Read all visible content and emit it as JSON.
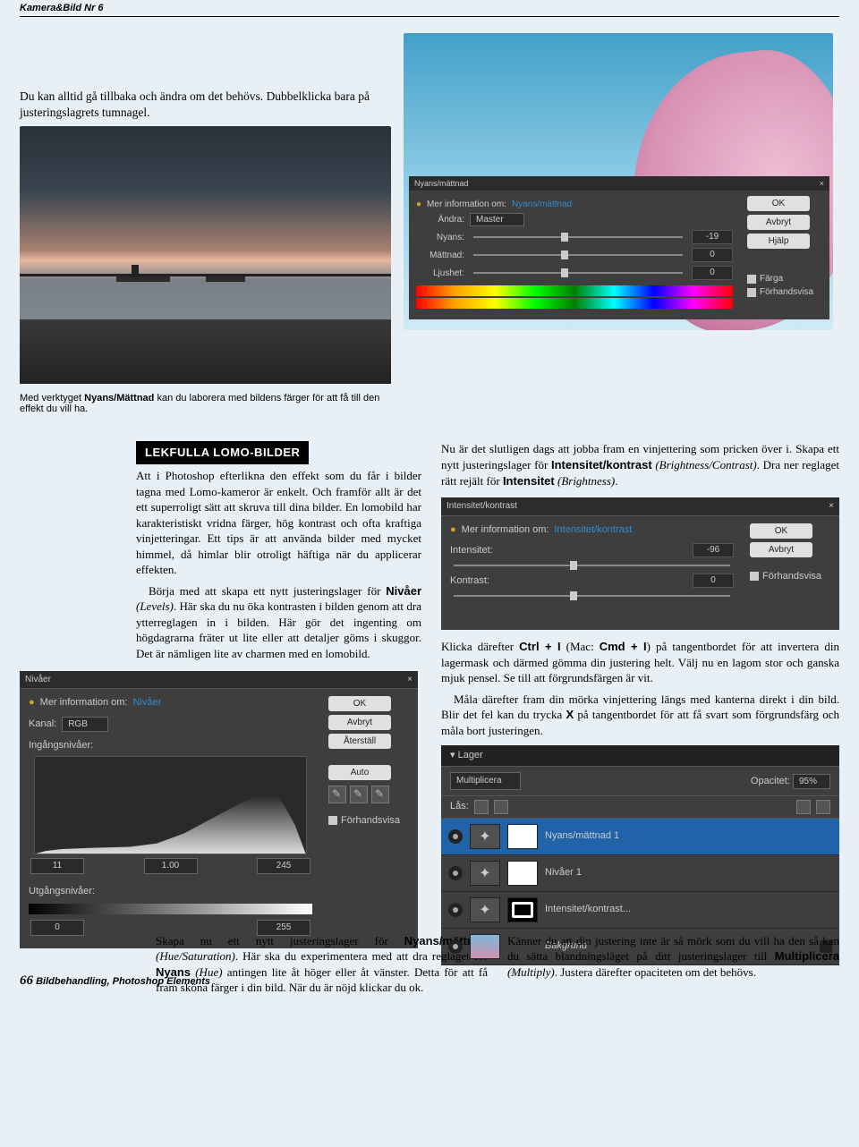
{
  "header": {
    "mag": "Kamera&Bild Nr 6"
  },
  "intro": {
    "l1": "Du kan alltid gå tillbaka och ändra om det behövs.",
    "l2": "Dubbelklicka bara på justeringslagrets tumnagel."
  },
  "caption_lake": {
    "pre": "Med verktyget ",
    "tool": "Nyans/Mättnad",
    "post": " kan du laborera med bildens färger för att få till den effekt du vill ha."
  },
  "hs_panel": {
    "title": "Nyans/mättnad",
    "info_pre": "Mer information om:",
    "info_link": "Nyans/mättnad",
    "edit_label": "Ändra:",
    "edit_val": "Master",
    "rows": {
      "hue": {
        "label": "Nyans:",
        "value": "-19"
      },
      "sat": {
        "label": "Mättnad:",
        "value": "0"
      },
      "light": {
        "label": "Ljushet:",
        "value": "0"
      }
    },
    "buttons": {
      "ok": "OK",
      "cancel": "Avbryt",
      "help": "Hjälp"
    },
    "opts": {
      "colorize": "Färga",
      "preview": "Förhandsvisa"
    }
  },
  "box": {
    "heading": "LEKFULLA LOMO-BILDER",
    "p1": "Att i Photoshop efterlikna den effekt som du får i bilder tagna med Lomo-kameror är enkelt. Och framför allt är det ett superroligt sätt att skruva till dina bilder. En lomobild har karakteristiskt vridna färger, hög kontrast och ofta kraftiga vinjetteringar. Ett tips är att använda bilder med mycket himmel, då himlar blir otroligt häftiga när du applicerar effekten.",
    "p2_a": "Börja med att skapa ett nytt justeringslager för ",
    "p2_b": "Nivåer",
    "p2_c": " (Levels)",
    "p2_d": ". Här ska du nu öka kontrasten i bilden genom att dra ytterreglagen in i bilden. Här gör det ingenting om högdagrarna fräter ut lite eller att detaljer göms i skuggor. Det är nämligen lite av charmen med en lomobild."
  },
  "col_r": {
    "p1_a": "Nu är det slutligen dags att jobba fram en vinjettering som pricken över i. Skapa ett nytt justeringslager för ",
    "p1_b": "Intensitet/kontrast",
    "p1_c": " (Brightness/Contrast)",
    "p1_d": ". Dra ner reglaget rätt rejält för ",
    "p1_e": "Intensitet",
    "p1_f": " (Brightness)",
    "p2_a": "Klicka därefter ",
    "p2_b": "Ctrl + I",
    "p2_c": " (Mac: ",
    "p2_d": "Cmd + I",
    "p2_e": ") på tangentbordet för att invertera din lagermask och därmed gömma din justering helt. Välj nu en lagom stor och ganska mjuk pensel. Se till att förgrundsfärgen är vit.",
    "p3_a": "Måla därefter fram din mörka vinjettering längs med kanterna direkt i din bild. Blir det fel kan du trycka ",
    "p3_b": "X",
    "p3_c": " på tangentbordet för att få svart som förgrundsfärg och måla bort justeringen."
  },
  "levels": {
    "title": "Nivåer",
    "info_pre": "Mer information om:",
    "info_link": "Nivåer",
    "channel_label": "Kanal:",
    "channel_val": "RGB",
    "input_label": "Ingångsnivåer:",
    "v0": "11",
    "v1": "1.00",
    "v2": "245",
    "output_label": "Utgångsnivåer:",
    "o0": "0",
    "o1": "255",
    "buttons": {
      "ok": "OK",
      "cancel": "Avbryt",
      "reset": "Återställ",
      "auto": "Auto"
    },
    "preview": "Förhandsvisa"
  },
  "ic": {
    "title": "Intensitet/kontrast",
    "info_pre": "Mer information om:",
    "info_link": "Intensitet/kontrast",
    "int_label": "Intensitet:",
    "int_val": "-96",
    "con_label": "Kontrast:",
    "con_val": "0",
    "ok": "OK",
    "cancel": "Avbryt",
    "preview": "Förhandsvisa"
  },
  "layers": {
    "title": "Lager",
    "blend": "Multiplicera",
    "opacity_label": "Opacitet:",
    "opacity_val": "95%",
    "lock_label": "Lås:",
    "items": [
      {
        "name": "Nyans/mättnad 1"
      },
      {
        "name": "Nivåer 1"
      },
      {
        "name": "Intensitet/kontrast..."
      },
      {
        "name": "Bakgrund"
      }
    ]
  },
  "bot_l": {
    "a": "Skapa nu ett nytt justeringslager för ",
    "b": "Nyans/mättnad",
    "c": " (Hue/Saturation)",
    "d": ". Här ska du experimentera med att dra reglaget för ",
    "e": "Nyans",
    "f": " (Hue)",
    "g": " antingen lite åt höger eller åt vänster. Detta för att få fram sköna färger i din bild. När du är nöjd klickar du ok."
  },
  "bot_r": {
    "a": "Känner du att din justering inte är så mörk som du vill ha den så kan du sätta blandningsläget på ditt justeringslager till ",
    "b": "Multiplicera",
    "c": " (Multiply)",
    "d": ". Justera därefter opaciteten om det behövs."
  },
  "footer": {
    "page": "66",
    "text": "Bildbehandling, Photoshop Elements"
  }
}
